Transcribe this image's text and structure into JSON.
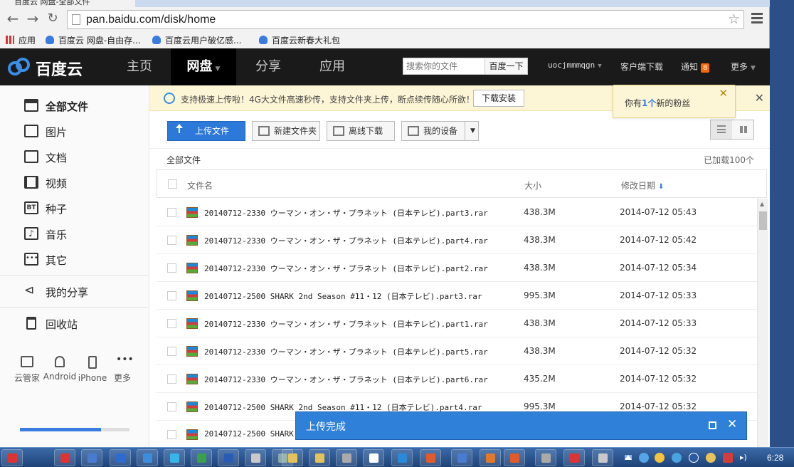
{
  "browser": {
    "tab_title": "百度云 网盘-全部文件",
    "url": "pan.baidu.com/disk/home",
    "bookmarks": [
      {
        "label": "应用",
        "icon": "apps-icon"
      },
      {
        "label": "百度云 网盘-自由存...",
        "icon": "baidu-cloud-icon"
      },
      {
        "label": "百度云用户破亿感...",
        "icon": "baidu-cloud-icon"
      },
      {
        "label": "百度云新春大礼包",
        "icon": "baidu-cloud-icon"
      }
    ]
  },
  "topnav": {
    "logo_text": "百度云",
    "items": [
      "主页",
      "网盘",
      "分享",
      "应用"
    ],
    "active": "网盘",
    "search_placeholder": "搜索你的文件",
    "search_button": "百度一下",
    "username": "uocjmmmqgn",
    "client_download": "客户端下载",
    "notifications": "通知",
    "notification_count": "8",
    "more": "更多"
  },
  "sidebar": {
    "items": [
      {
        "label": "全部文件",
        "icon": "all-files-icon"
      },
      {
        "label": "图片",
        "icon": "image-icon"
      },
      {
        "label": "文档",
        "icon": "document-icon"
      },
      {
        "label": "视频",
        "icon": "video-icon"
      },
      {
        "label": "种子",
        "icon": "bt-torrent-icon"
      },
      {
        "label": "音乐",
        "icon": "music-icon"
      },
      {
        "label": "其它",
        "icon": "other-icon"
      },
      {
        "label": "我的分享",
        "icon": "share-icon"
      },
      {
        "label": "回收站",
        "icon": "trash-icon"
      }
    ],
    "devices": [
      {
        "label": "云管家",
        "icon": "desktop-icon"
      },
      {
        "label": "Android",
        "icon": "android-icon"
      },
      {
        "label": "iPhone",
        "icon": "iphone-icon"
      },
      {
        "label": "更多",
        "icon": "more-dots-icon"
      }
    ],
    "quota_used_fraction": 0.74
  },
  "notice": {
    "text": "支持极速上传啦！4G大文件高速秒传，支持文件夹上传，断点续传随心所欲！",
    "button": "下载安装"
  },
  "fans_popup": {
    "prefix": "你有",
    "count": "1个",
    "suffix": "新的粉丝"
  },
  "toolbar": {
    "upload": "上传文件",
    "new_folder": "新建文件夹",
    "offline_download": "离线下载",
    "my_devices": "我的设备"
  },
  "breadcrumb": "全部文件",
  "loaded_count": "已加载100个",
  "table": {
    "headers": {
      "name": "文件名",
      "size": "大小",
      "date": "修改日期"
    },
    "rows": [
      {
        "name": "20140712-2330 ウーマン・オン・ザ・プラネット (日本テレビ).part3.rar",
        "size": "438.3M",
        "date": "2014-07-12 05:43"
      },
      {
        "name": "20140712-2330 ウーマン・オン・ザ・プラネット (日本テレビ).part4.rar",
        "size": "438.3M",
        "date": "2014-07-12 05:42"
      },
      {
        "name": "20140712-2330 ウーマン・オン・ザ・プラネット (日本テレビ).part2.rar",
        "size": "438.3M",
        "date": "2014-07-12 05:34"
      },
      {
        "name": "20140712-2500 SHARK  2nd  Season  #11・12 (日本テレビ).part3.rar",
        "size": "995.3M",
        "date": "2014-07-12 05:33"
      },
      {
        "name": "20140712-2330 ウーマン・オン・ザ・プラネット (日本テレビ).part1.rar",
        "size": "438.3M",
        "date": "2014-07-12 05:33"
      },
      {
        "name": "20140712-2330 ウーマン・オン・ザ・プラネット (日本テレビ).part5.rar",
        "size": "438.3M",
        "date": "2014-07-12 05:32"
      },
      {
        "name": "20140712-2330 ウーマン・オン・ザ・プラネット (日本テレビ).part6.rar",
        "size": "435.2M",
        "date": "2014-07-12 05:32"
      },
      {
        "name": "20140712-2500 SHARK  2nd  Season  #11・12 (日本テレビ).part4.rar",
        "size": "995.3M",
        "date": "2014-07-12 05:32"
      },
      {
        "name": "20140712-2500 SHARK",
        "size": "",
        "date": ""
      }
    ]
  },
  "upload_panel": {
    "title": "上传完成"
  },
  "taskbar": {
    "clock": "6:28"
  }
}
